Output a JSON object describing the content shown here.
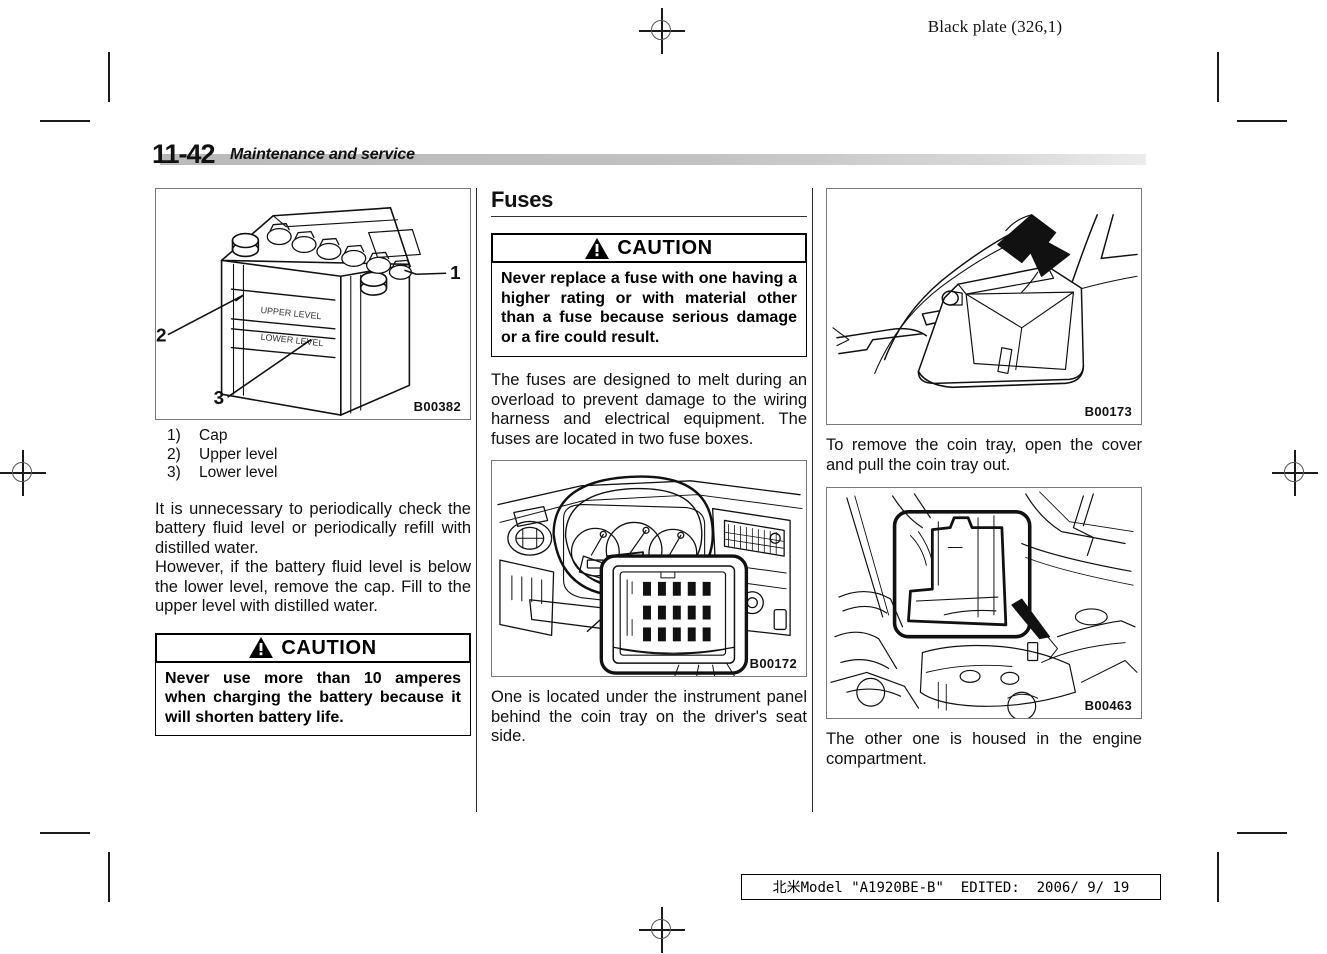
{
  "header": {
    "black_plate": "Black plate (326,1)"
  },
  "title": {
    "page_number": "11-42",
    "section": "Maintenance and service"
  },
  "footer": {
    "stamp": "北米Model \"A1920BE-B\"  EDITED:  2006/ 9/ 19"
  },
  "column_left": {
    "figure": {
      "code": "B00382",
      "label_1": "1",
      "label_2": "2",
      "label_3": "3",
      "upper_level_text": "UPPER LEVEL",
      "lower_level_text": "LOWER LEVEL"
    },
    "legend": [
      {
        "num": "1)",
        "text": "Cap"
      },
      {
        "num": "2)",
        "text": "Upper level"
      },
      {
        "num": "3)",
        "text": "Lower level"
      }
    ],
    "paragraph_1": "It is unnecessary to periodically check the battery fluid level or periodically refill with distilled water.",
    "paragraph_2": "However, if the battery fluid level is below the lower level, remove the cap. Fill to the upper level with distilled water.",
    "caution": {
      "icon": "warning-triangle-icon",
      "heading": "CAUTION",
      "text": "Never use more than 10 amperes when charging the battery because it will shorten battery life."
    }
  },
  "column_middle": {
    "heading": "Fuses",
    "caution": {
      "icon": "warning-triangle-icon",
      "heading": "CAUTION",
      "text": "Never replace a fuse with one having a higher rating or with material other than a fuse because serious damage or a fire could result."
    },
    "paragraph_1": "The fuses are designed to melt during an overload to prevent damage to the wiring harness and electrical equipment. The fuses are located in two fuse boxes.",
    "figure": {
      "code": "B00172"
    },
    "paragraph_2": "One is located under the instrument panel behind the coin tray on the driver's seat side."
  },
  "column_right": {
    "figure_top": {
      "code": "B00173"
    },
    "paragraph_1": "To remove the coin tray, open the cover and pull the coin tray out.",
    "figure_bottom": {
      "code": "B00463"
    },
    "paragraph_2": "The other one is housed in the engine compartment."
  }
}
